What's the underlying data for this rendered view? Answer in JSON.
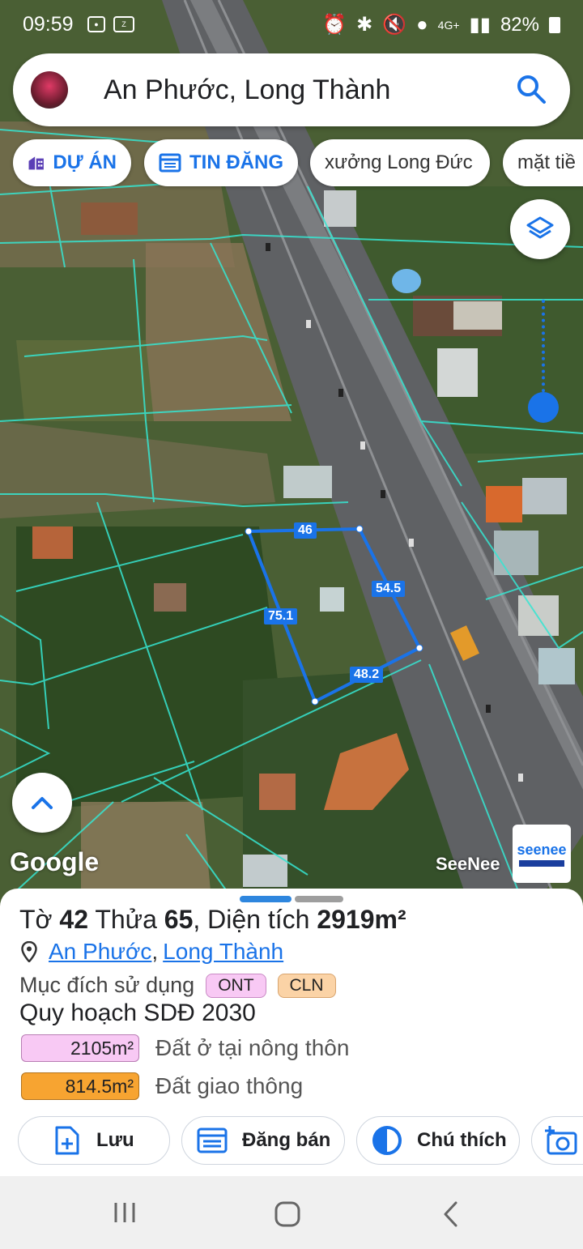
{
  "status_bar": {
    "time": "09:59",
    "left_icons": [
      "recorder-icon",
      "zalo-icon"
    ],
    "right_icons": [
      "alarm-icon",
      "bluetooth-icon",
      "mute-icon",
      "location-icon"
    ],
    "network": "4G+",
    "battery": "82%"
  },
  "search": {
    "query": "An Phước, Long Thành"
  },
  "chips": [
    {
      "label": "DỰ ÁN",
      "icon": "building-icon"
    },
    {
      "label": "TIN ĐĂNG",
      "icon": "listing-icon"
    },
    {
      "label": "xưởng Long Đức"
    },
    {
      "label": "mặt tiề"
    }
  ],
  "map": {
    "plot_edges": [
      "46",
      "54.5",
      "75.1",
      "48.2"
    ],
    "attribution": "Google",
    "brand_label": "SeeNee",
    "brand_logo_text": "seenee",
    "plot_color": "#1a73e8"
  },
  "sheet": {
    "sheet_label": "Tờ",
    "sheet_no": "42",
    "parcel_label": "Thửa",
    "parcel_no": "65",
    "area_label": "Diện tích",
    "area_value": "2919m²",
    "location": {
      "ward": "An Phước",
      "district": "Long Thành"
    },
    "purpose_label": "Mục đích sử dụng",
    "purpose_tags": [
      "ONT",
      "CLN"
    ],
    "planning_title": "Quy hoạch SDĐ 2030",
    "planning_rows": [
      {
        "area": "2105m²",
        "desc": "Đất ở tại nông thôn",
        "color": "#f8c9f4"
      },
      {
        "area": "814.5m²",
        "desc": "Đất giao thông",
        "color": "#f7a431"
      }
    ],
    "actions": [
      {
        "label": "Lưu",
        "icon": "save-doc-icon"
      },
      {
        "label": "Đăng bán",
        "icon": "listing-icon"
      },
      {
        "label": "Chú thích",
        "icon": "legend-icon"
      },
      {
        "label": "",
        "icon": "add-photo-icon"
      }
    ]
  },
  "nav": {
    "buttons": [
      "recent-apps-icon",
      "home-icon",
      "back-icon"
    ]
  }
}
